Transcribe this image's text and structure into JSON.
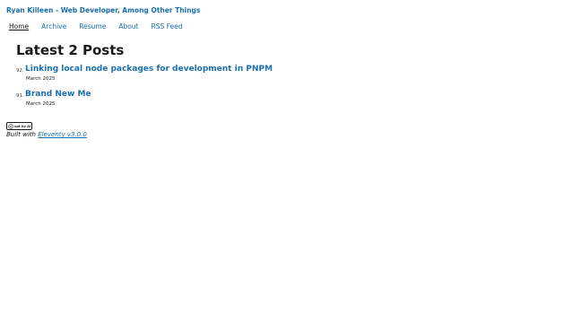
{
  "site": {
    "title": "Ryan Killeen - Web Developer, Among Other Things"
  },
  "nav": {
    "items": [
      {
        "label": "Home",
        "current": true
      },
      {
        "label": "Archive"
      },
      {
        "label": "Resume"
      },
      {
        "label": "About"
      },
      {
        "label": "RSS Feed"
      }
    ]
  },
  "main": {
    "heading": "Latest 2 Posts",
    "posts": [
      {
        "number": "92.",
        "title": "Linking local node packages for development in PNPM",
        "date": "March 2025"
      },
      {
        "number": "91.",
        "title": "Brand New Me",
        "date": "March 2025"
      }
    ]
  },
  "footer": {
    "badge_text": "not by AI",
    "built_prefix": "Built with",
    "built_link": "Eleventy v3.0.0"
  },
  "colors": {
    "link": "#1a6fb0",
    "text": "#1a1a1a"
  }
}
